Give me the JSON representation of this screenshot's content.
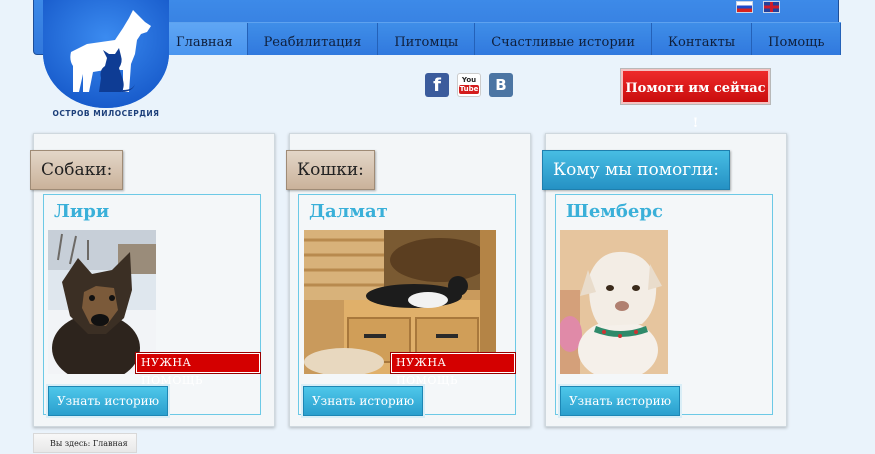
{
  "header": {
    "languages": [
      {
        "code": "ru",
        "icon": "russia-flag-icon"
      },
      {
        "code": "en",
        "icon": "uk-flag-icon"
      }
    ],
    "nav": [
      {
        "label": "Главная",
        "active": true
      },
      {
        "label": "Реабилитация"
      },
      {
        "label": "Питомцы"
      },
      {
        "label": "Счастливые истории"
      },
      {
        "label": "Контакты"
      },
      {
        "label": "Помощь"
      }
    ]
  },
  "logo": {
    "caption": "ОСТРОВ МИЛОСЕРДИЯ",
    "icon": "dog-cat-logo-icon"
  },
  "social": [
    {
      "name": "facebook",
      "glyph": "f"
    },
    {
      "name": "youtube",
      "top": "You",
      "bottom": "Tube"
    },
    {
      "name": "vkontakte",
      "glyph": "B"
    }
  ],
  "help_button": "Помоги им сейчас !",
  "cards": [
    {
      "tab": "Собаки:",
      "pet_name": "Лири",
      "badge": "НУЖНА ПОМОЩЬ",
      "button": "Узнать историю"
    },
    {
      "tab": "Кошки:",
      "pet_name": "Далмат",
      "badge": "НУЖНА ПОМОЩЬ",
      "button": "Узнать историю"
    },
    {
      "tab": "Кому мы помогли:",
      "pet_name": "Шемберс",
      "button": "Узнать историю"
    }
  ],
  "breadcrumb": "Вы здесь: Главная",
  "colors": {
    "header_blue": "#3278dc",
    "accent_cyan": "#3ab0d9",
    "badge_red": "#d40000",
    "help_red": "#d81515"
  }
}
